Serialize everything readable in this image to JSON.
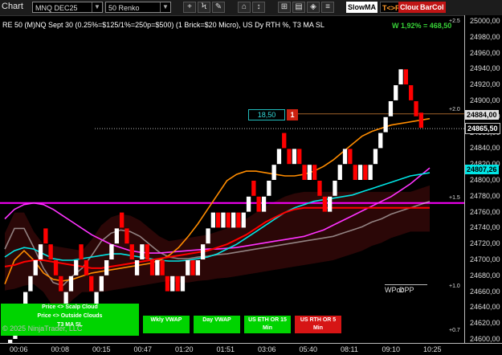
{
  "toolbar": {
    "title": "Chart",
    "instrument": "MNQ DEC25",
    "bar_type": "50 Renko",
    "buttons": [
      "+",
      "Ϟ",
      "✎",
      "⌂",
      "↕",
      "⊞",
      "▤",
      "◈",
      "≡"
    ],
    "slowma_label": "SlowMA",
    "t_label": "T<>R",
    "cloud_label": "Cloud",
    "barcol_label": "BarCol"
  },
  "header": {
    "description": "RE 50 (M)NQ Sept 30 (0.25%=$125/1%=250p=$500)  (1 Brick=$20 Micro), US Dy RTH %, T3 MA SL",
    "pnl": "W 1,92% = 468,50"
  },
  "price_axis": {
    "ticks": [
      "25000,00",
      "24980,00",
      "24960,00",
      "24940,00",
      "24920,00",
      "24900,00",
      "24880,00",
      "24860,00",
      "24840,00",
      "24820,00",
      "24800,00",
      "24780,00",
      "24760,00",
      "24740,00",
      "24720,00",
      "24700,00",
      "24680,00",
      "24660,00",
      "24640,00",
      "24620,00",
      "24600,00"
    ],
    "highlight_1": "24884,00",
    "highlight_2": "24865,50",
    "highlight_3": "24807,26",
    "plus_labels": [
      "+2.5",
      "+2.0",
      "+1.5",
      "+1.0",
      "+0.7"
    ]
  },
  "time_axis": {
    "ticks": [
      "00:06",
      "00:08",
      "00:15",
      "00:47",
      "01:20",
      "01:51",
      "03:06",
      "05:40",
      "08:11",
      "09:10",
      "10:25"
    ]
  },
  "chart_data": {
    "type": "line",
    "title": "",
    "price_range": [
      24596,
      25008
    ],
    "bricks": [
      {
        "p": 24600,
        "d": 1
      },
      {
        "p": 24620,
        "d": 1
      },
      {
        "p": 24640,
        "d": 1
      },
      {
        "p": 24660,
        "d": 1
      },
      {
        "p": 24680,
        "d": 1
      },
      {
        "p": 24700,
        "d": 1
      },
      {
        "p": 24720,
        "d": 1
      },
      {
        "p": 24720,
        "d": -1
      },
      {
        "p": 24700,
        "d": -1
      },
      {
        "p": 24680,
        "d": -1
      },
      {
        "p": 24660,
        "d": -1
      },
      {
        "p": 24660,
        "d": 1
      },
      {
        "p": 24680,
        "d": 1
      },
      {
        "p": 24700,
        "d": 1
      },
      {
        "p": 24700,
        "d": -1
      },
      {
        "p": 24680,
        "d": -1
      },
      {
        "p": 24660,
        "d": -1
      },
      {
        "p": 24660,
        "d": 1
      },
      {
        "p": 24680,
        "d": 1
      },
      {
        "p": 24700,
        "d": 1
      },
      {
        "p": 24720,
        "d": 1
      },
      {
        "p": 24740,
        "d": 1
      },
      {
        "p": 24740,
        "d": -1
      },
      {
        "p": 24720,
        "d": -1
      },
      {
        "p": 24700,
        "d": -1
      },
      {
        "p": 24700,
        "d": 1
      },
      {
        "p": 24720,
        "d": 1
      },
      {
        "p": 24700,
        "d": -1
      },
      {
        "p": 24680,
        "d": -1
      },
      {
        "p": 24700,
        "d": 1
      },
      {
        "p": 24680,
        "d": -1
      },
      {
        "p": 24660,
        "d": -1
      },
      {
        "p": 24680,
        "d": 1
      },
      {
        "p": 24660,
        "d": -1
      },
      {
        "p": 24680,
        "d": 1
      },
      {
        "p": 24700,
        "d": 1
      },
      {
        "p": 24680,
        "d": -1
      },
      {
        "p": 24700,
        "d": 1
      },
      {
        "p": 24720,
        "d": 1
      },
      {
        "p": 24740,
        "d": 1
      },
      {
        "p": 24760,
        "d": 1
      },
      {
        "p": 24740,
        "d": -1
      },
      {
        "p": 24760,
        "d": 1
      },
      {
        "p": 24740,
        "d": -1
      },
      {
        "p": 24760,
        "d": 1
      },
      {
        "p": 24740,
        "d": -1
      },
      {
        "p": 24760,
        "d": 1
      },
      {
        "p": 24780,
        "d": 1
      },
      {
        "p": 24780,
        "d": -1
      },
      {
        "p": 24760,
        "d": -1
      },
      {
        "p": 24780,
        "d": 1
      },
      {
        "p": 24800,
        "d": 1
      },
      {
        "p": 24820,
        "d": 1
      },
      {
        "p": 24840,
        "d": 1
      },
      {
        "p": 24840,
        "d": -1
      },
      {
        "p": 24820,
        "d": -1
      },
      {
        "p": 24840,
        "d": 1
      },
      {
        "p": 24820,
        "d": -1
      },
      {
        "p": 24800,
        "d": -1
      },
      {
        "p": 24820,
        "d": 1
      },
      {
        "p": 24800,
        "d": -1
      },
      {
        "p": 24780,
        "d": -1
      },
      {
        "p": 24760,
        "d": -1
      },
      {
        "p": 24780,
        "d": 1
      },
      {
        "p": 24800,
        "d": 1
      },
      {
        "p": 24820,
        "d": 1
      },
      {
        "p": 24840,
        "d": 1
      },
      {
        "p": 24820,
        "d": -1
      },
      {
        "p": 24800,
        "d": -1
      },
      {
        "p": 24820,
        "d": 1
      },
      {
        "p": 24800,
        "d": -1
      },
      {
        "p": 24820,
        "d": 1
      },
      {
        "p": 24840,
        "d": 1
      },
      {
        "p": 24860,
        "d": 1
      },
      {
        "p": 24880,
        "d": 1
      },
      {
        "p": 24900,
        "d": 1
      },
      {
        "p": 24920,
        "d": 1
      },
      {
        "p": 24940,
        "d": 1
      },
      {
        "p": 24920,
        "d": -1
      },
      {
        "p": 24900,
        "d": -1
      },
      {
        "p": 24880,
        "d": -1
      },
      {
        "p": 24865.5,
        "d": -1
      }
    ],
    "series": [
      {
        "color": "#e8e8e8",
        "values": [
          24714,
          24740,
          24740,
          24716,
          24690,
          24672,
          24668,
          24680,
          24690,
          24706,
          24724,
          24734,
          24738,
          24736,
          24730,
          24720,
          24710,
          24704,
          24702,
          24702,
          24704,
          24705,
          24707,
          24708,
          24710,
          24712,
          24714,
          24716,
          24718,
          24720,
          24722,
          24724,
          24726,
          24728,
          24730,
          24734,
          24738,
          24742,
          24748,
          24752,
          24758,
          24762,
          24766,
          24770,
          24774
        ]
      },
      {
        "color": "#ff33ff",
        "values": [
          24752,
          24764,
          24770,
          24772,
          24770,
          24764,
          24756,
          24748,
          24740,
          24732,
          24726,
          24720,
          24716,
          24712,
          24710,
          24709,
          24709,
          24710,
          24711,
          24712,
          24713,
          24714,
          24714,
          24715,
          24716,
          24718,
          24720,
          24722,
          24724,
          24726,
          24728,
          24730,
          24734,
          24738,
          24744,
          24750,
          24756,
          24762,
          24768,
          24774,
          24780,
          24788,
          24796,
          24806,
          24816
        ]
      },
      {
        "color": "#00e5e5",
        "values": [
          24704,
          24712,
          24716,
          24714,
          24708,
          24702,
          24700,
          24700,
          24702,
          24704,
          24706,
          24708,
          24708,
          24706,
          24704,
          24702,
          24700,
          24699,
          24699,
          24700,
          24702,
          24704,
          24708,
          24714,
          24720,
          24728,
          24736,
          24744,
          24752,
          24760,
          24766,
          24770,
          24774,
          24776,
          24778,
          24780,
          24782,
          24786,
          24790,
          24794,
          24798,
          24802,
          24806,
          24808,
          24810
        ]
      },
      {
        "color": "#ff8c00",
        "values": [
          24670,
          24700,
          24712,
          24700,
          24684,
          24676,
          24674,
          24676,
          24680,
          24684,
          24686,
          24688,
          24690,
          24692,
          24694,
          24696,
          24700,
          24706,
          24716,
          24730,
          24746,
          24764,
          24782,
          24800,
          24808,
          24812,
          24812,
          24810,
          24808,
          24806,
          24806,
          24808,
          24812,
          24818,
          24826,
          24836,
          24846,
          24856,
          24862,
          24866,
          24870,
          24872,
          24874,
          24876,
          24878
        ]
      },
      {
        "color": "#ff0000",
        "values": [
          24692,
          24694,
          24698,
          24700,
          24700,
          24698,
          24696,
          24694,
          24692,
          24690,
          24690,
          24692,
          24694,
          24696,
          24698,
          24700,
          24702,
          24704,
          24706,
          24708,
          24710,
          24712,
          24716,
          24720,
          24726,
          24732,
          24740,
          24748,
          24754,
          24760,
          24764,
          24766,
          24766,
          24766,
          24766,
          24766,
          24766,
          24766,
          24766,
          24766,
          24766,
          24766,
          24766,
          24766,
          24766
        ]
      }
    ]
  },
  "overlay": {
    "calc_value": "18,50",
    "calc_count": "1",
    "wpoc_label": "WPoc",
    "dpp_label": "DPP",
    "copyright": "© 2025 NinjaTrader, LLC"
  },
  "panel_buttons": {
    "scalp_cloud": "Price <> Scalp Cloud",
    "outside_clouds": "Price <> Outside Clouds",
    "t3_ma_sl": "T3 MA SL",
    "wkly_vwap": "Wkly VWAP",
    "day_vwap": "Day VWAP",
    "us_eth": "US ETH OR 15 Min",
    "us_rth": "US RTH OR 5 Min"
  },
  "colors": {
    "bull_brick": "#ffffff",
    "bear_brick": "#ff0000",
    "pos_pnl": "#37d137",
    "accent_green": "#00d400",
    "magenta_level": "#ff00ff"
  }
}
